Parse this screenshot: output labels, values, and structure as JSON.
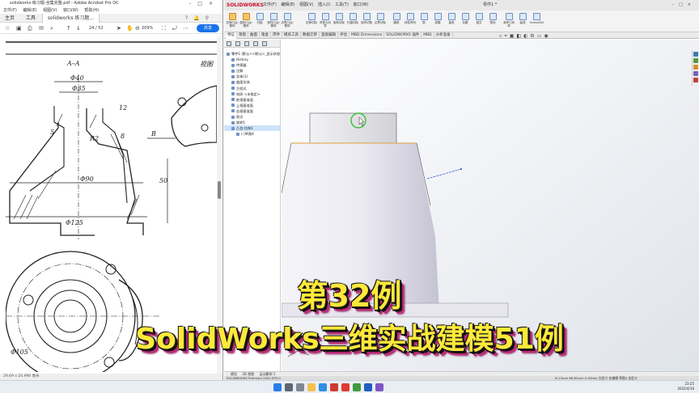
{
  "acrobat": {
    "title": "solidworks 练习题-全集完整.pdf - Adobe Acrobat Pro DC",
    "menu": [
      "文件(F)",
      "编辑(E)",
      "视图(V)",
      "窗口(W)",
      "帮助(H)"
    ],
    "tabs": {
      "home": "主页",
      "tools": "工具",
      "document": "solidworks 练习题..."
    },
    "page_current": "24",
    "page_total": "/ 52",
    "zoom": "209%",
    "share_label": "共享",
    "status": "29.69 x 20.996 厘米",
    "drawing": {
      "section_label": "A–A",
      "partial_view_label": "视图",
      "dims": [
        "Φ40",
        "Φ35",
        "5",
        "12",
        "R2",
        "8",
        "B",
        "Φ90",
        "50",
        "Φ125",
        "Φ105"
      ]
    }
  },
  "solidworks": {
    "logo": "SOLIDWORKS",
    "menu": [
      "文件(F)",
      "编辑(E)",
      "视图(V)",
      "插入(I)",
      "工具(T)",
      "窗口(W)"
    ],
    "document_title": "零件1 *",
    "ribbon_buttons": [
      "拉伸凸台/基体",
      "旋转凸台/基体",
      "扫描",
      "放样凸台/基体",
      "边界凸台/基体",
      "拉伸切除",
      "异型孔向导",
      "旋转切除",
      "扫描切除",
      "放样切割",
      "边界切除",
      "圆角",
      "线性阵列",
      "筋",
      "拔模",
      "抽壳",
      "包覆",
      "相交",
      "镜向",
      "参考几何体",
      "曲线",
      "Instant3D"
    ],
    "command_tabs": [
      "特征",
      "草图",
      "曲面",
      "钣金",
      "焊件",
      "模具工具",
      "数据迁移",
      "直接编辑",
      "评估",
      "MBD Dimensions",
      "SOLIDWORKS 插件",
      "MBD",
      "分析准备"
    ],
    "active_command_tab": "特征",
    "feature_tree": [
      "零件1 (默认<<默认>_显示状态 1>)",
      "History",
      "传感器",
      "注解",
      "实体(1)",
      "曲面实体",
      "方程式",
      "材质 <未指定>",
      "前视基准面",
      "上视基准面",
      "右视基准面",
      "原点",
      "旋转1",
      "凸台-拉伸1",
      "(-)草图4"
    ],
    "selected_tree_item": "凸台-拉伸1",
    "viewport_tabs": [
      "模型",
      "3D 视图",
      "运动算例 1"
    ],
    "status_left": "SOLIDWORKS Premium 2020 SP5.0",
    "status_right": "-8.13mm     66.61mm  0.00mm  欠定义     在编辑 草图4     自定义"
  },
  "taskbar": {
    "time": "23:25",
    "date": "2022/4/16"
  },
  "caption": {
    "line1": "第32例",
    "line2": "SolidWorks三维实战建模51例"
  }
}
